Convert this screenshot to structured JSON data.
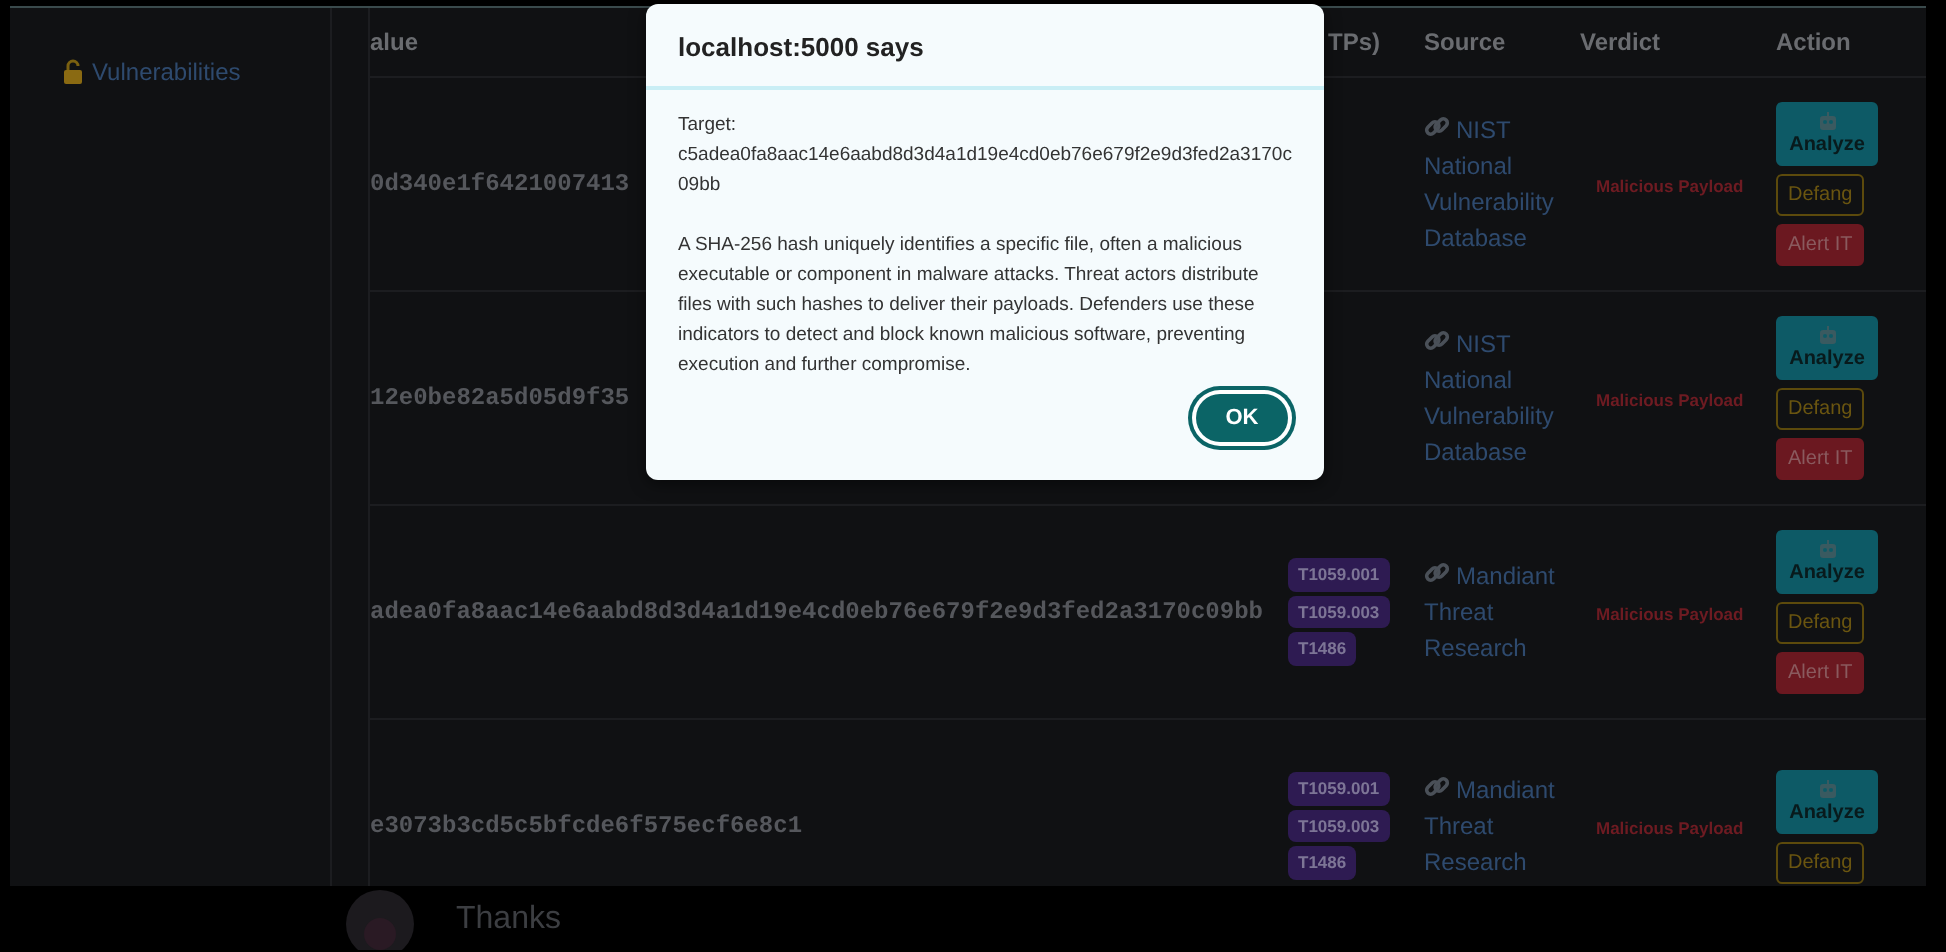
{
  "sidebar": {
    "items": [
      {
        "label": "Vulnerabilities"
      }
    ]
  },
  "table": {
    "columns": [
      "alue",
      "TPs)",
      "Source",
      "Verdict",
      "Action"
    ],
    "rows": [
      {
        "value": "0d340e1f6421007413",
        "ttps": [],
        "source": "NIST National Vulnerability Database",
        "verdict": "Malicious Payload",
        "actions": [
          "Analyze",
          "Defang",
          "Alert IT"
        ]
      },
      {
        "value": "12e0be82a5d05d9f35",
        "ttps": [],
        "source": "NIST National Vulnerability Database",
        "verdict": "Malicious Payload",
        "actions": [
          "Analyze",
          "Defang",
          "Alert IT"
        ]
      },
      {
        "value": "adea0fa8aac14e6aabd8d3d4a1d19e4cd0eb76e679f2e9d3fed2a3170c09bb",
        "ttps": [
          "T1059.001",
          "T1059.003",
          "T1486"
        ],
        "source": "Mandiant Threat Research",
        "verdict": "Malicious Payload",
        "actions": [
          "Analyze",
          "Defang",
          "Alert IT"
        ]
      },
      {
        "value": "e3073b3cd5c5bfcde6f575ecf6e8c1",
        "ttps": [
          "T1059.001",
          "T1059.003",
          "T1486"
        ],
        "source": "Mandiant Threat Research",
        "verdict": "Malicious Payload",
        "actions": [
          "Analyze",
          "Defang"
        ]
      }
    ]
  },
  "dialog": {
    "title": "localhost:5000 says",
    "target_label": "Target:",
    "target": "c5adea0fa8aac14e6aabd8d3d4a1d19e4cd0eb76e679f2e9d3fed2a3170c09bb",
    "message": "A SHA-256 hash uniquely identifies a specific file, often a malicious executable or component in malware attacks. Threat actors distribute files with such hashes to deliver their payloads. Defenders use these indicators to detect and block known malicious software, preventing execution and further compromise.",
    "button": "OK"
  },
  "chat": {
    "message": "Thanks"
  }
}
